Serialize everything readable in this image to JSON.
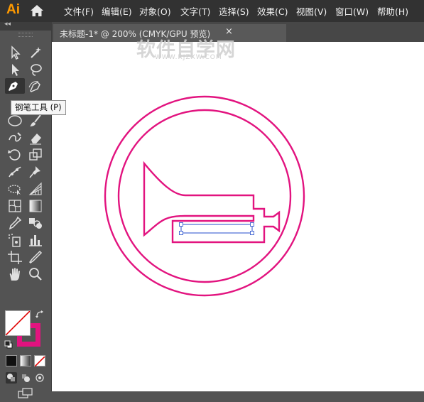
{
  "app": {
    "logo": "Ai"
  },
  "menu": [
    "文件(F)",
    "编辑(E)",
    "对象(O)",
    "文字(T)",
    "选择(S)",
    "效果(C)",
    "视图(V)",
    "窗口(W)",
    "帮助(H)"
  ],
  "document_tab": {
    "title": "未标题-1* @ 200% (CMYK/GPU 预览)",
    "close": "×"
  },
  "watermark": {
    "text": "软件自学网",
    "sub": "WWW.RJZXW.COM"
  },
  "tooltip": "钢笔工具 (P)",
  "toolbar": {
    "collapse": "◂◂",
    "tools": [
      "selection-tool",
      "magic-wand-tool",
      "direct-selection-tool",
      "lasso-tool",
      "pen-tool",
      "curvature-tool",
      "ellipse-tool",
      "paintbrush-tool",
      "shaper-tool",
      "eraser-tool",
      "rotate-tool",
      "scale-tool",
      "puppet-warp-tool",
      "pin-tool",
      "free-transform-tool",
      "perspective-grid-tool",
      "mesh-tool",
      "gradient-tool",
      "eyedropper-tool",
      "blend-tool",
      "symbol-sprayer-tool",
      "column-graph-tool",
      "artboard-tool",
      "slice-tool",
      "hand-tool",
      "zoom-tool"
    ]
  },
  "colors": {
    "stroke": "#e2137f",
    "fill": "none",
    "selection": "#4a6cd4",
    "accent": "#ff9a00"
  }
}
